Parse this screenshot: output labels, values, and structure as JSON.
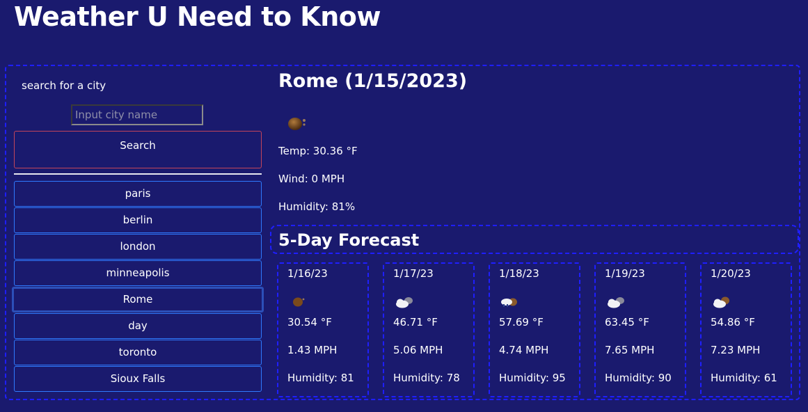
{
  "header": {
    "title": "Weather U Need to Know"
  },
  "search": {
    "label": "search for a city",
    "placeholder": "Input city name",
    "button_label": "Search"
  },
  "history": {
    "cities": [
      "paris",
      "berlin",
      "london",
      "minneapolis",
      "Rome",
      "day",
      "toronto",
      "Sioux Falls"
    ],
    "selected": "Rome"
  },
  "current": {
    "title": "Rome (1/15/2023)",
    "icon": "night-cloud-icon",
    "temp": "Temp: 30.36 °F",
    "wind": "Wind: 0 MPH",
    "humidity": "Humidity: 81%"
  },
  "forecast": {
    "title": "5-Day Forecast",
    "days": [
      {
        "date": "1/16/23",
        "icon": "night-moon-icon",
        "temp": "30.54 °F",
        "wind": "1.43 MPH",
        "humidity": "Humidity: 81"
      },
      {
        "date": "1/17/23",
        "icon": "cloudy-icon",
        "temp": "46.71 °F",
        "wind": "5.06 MPH",
        "humidity": "Humidity: 78"
      },
      {
        "date": "1/18/23",
        "icon": "rain-cloud-icon",
        "temp": "57.69 °F",
        "wind": "4.74 MPH",
        "humidity": "Humidity: 95"
      },
      {
        "date": "1/19/23",
        "icon": "cloudy-icon",
        "temp": "63.45 °F",
        "wind": "7.65 MPH",
        "humidity": "Humidity: 90"
      },
      {
        "date": "1/20/23",
        "icon": "partly-cloudy-night-icon",
        "temp": "54.86 °F",
        "wind": "7.23 MPH",
        "humidity": "Humidity: 61"
      }
    ]
  },
  "colors": {
    "background": "#1a1a6e",
    "frame_border": "#1f1fff",
    "city_button_border": "#2f7bff",
    "search_button_border": "#c4455a"
  }
}
